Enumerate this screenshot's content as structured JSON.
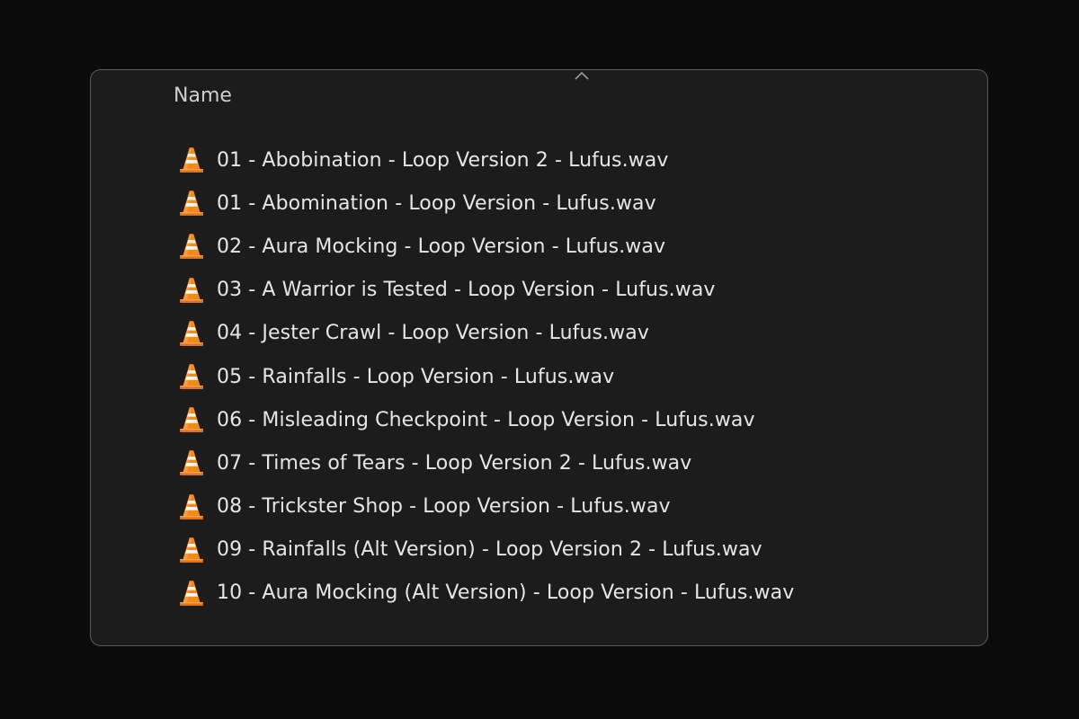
{
  "column_header": {
    "name_label": "Name"
  },
  "icons": {
    "sort": "chevron-up-icon",
    "file": "vlc-cone-icon"
  },
  "colors": {
    "background": "#0b0b0b",
    "window": "#1c1c1c",
    "text": "#e6e6e6",
    "cone_orange": "#f28a1a"
  },
  "files": [
    {
      "name": "01 - Abobination - Loop Version 2 - Lufus.wav"
    },
    {
      "name": "01 - Abomination - Loop Version - Lufus.wav"
    },
    {
      "name": "02 - Aura Mocking - Loop Version - Lufus.wav"
    },
    {
      "name": "03 - A Warrior is Tested - Loop Version - Lufus.wav"
    },
    {
      "name": "04 - Jester Crawl - Loop Version - Lufus.wav"
    },
    {
      "name": "05 - Rainfalls - Loop Version - Lufus.wav"
    },
    {
      "name": "06 - Misleading Checkpoint - Loop Version - Lufus.wav"
    },
    {
      "name": "07 - Times of Tears - Loop Version 2 - Lufus.wav"
    },
    {
      "name": "08 - Trickster Shop - Loop Version - Lufus.wav"
    },
    {
      "name": "09 - Rainfalls (Alt Version) - Loop Version 2 - Lufus.wav"
    },
    {
      "name": "10 - Aura Mocking (Alt Version) - Loop Version - Lufus.wav"
    }
  ]
}
